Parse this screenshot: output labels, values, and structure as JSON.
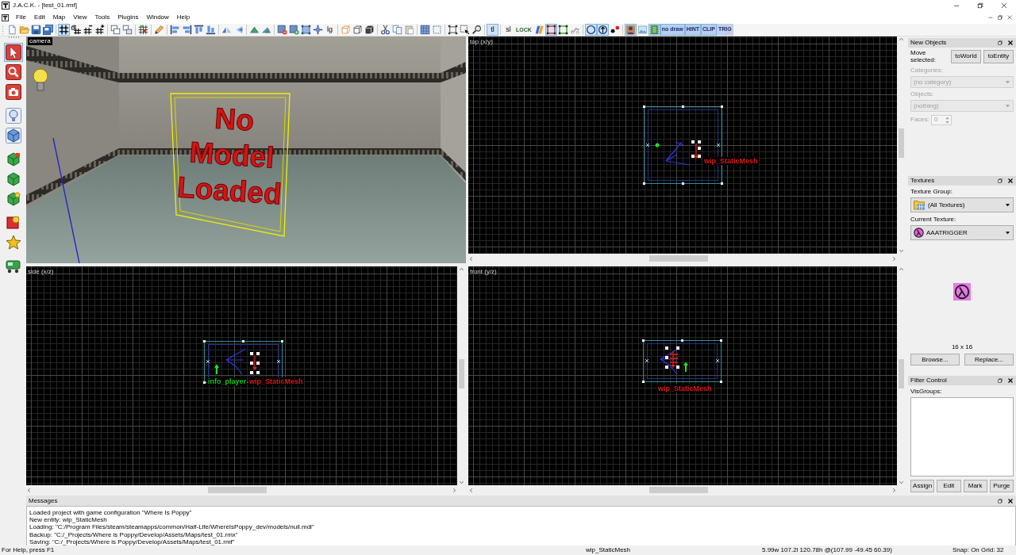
{
  "window": {
    "title": "J.A.C.K. - [test_01.rmf]"
  },
  "menu": [
    "File",
    "Edit",
    "Map",
    "View",
    "Tools",
    "Plugins",
    "Window",
    "Help"
  ],
  "toolbar": [
    {
      "buttons": [
        {
          "kind": "icon",
          "on": false
        },
        {
          "kind": "icon",
          "on": false
        },
        {
          "kind": "icon",
          "on": false
        },
        {
          "kind": "icon",
          "on": false
        }
      ]
    },
    {
      "buttons": [
        {
          "kind": "icon",
          "on": true
        },
        {
          "kind": "icon",
          "on": false
        },
        {
          "kind": "icon",
          "on": false
        },
        {
          "kind": "icon",
          "on": false
        }
      ]
    },
    {
      "buttons": [
        {
          "kind": "icon",
          "on": false
        },
        {
          "kind": "icon",
          "on": false
        }
      ]
    },
    {
      "buttons": [
        {
          "kind": "icon",
          "on": false
        }
      ]
    },
    {
      "buttons": [
        {
          "kind": "icon",
          "on": false
        }
      ]
    },
    {
      "buttons": [
        {
          "kind": "icon",
          "on": false
        },
        {
          "kind": "icon",
          "on": false
        },
        {
          "kind": "icon",
          "on": false
        },
        {
          "kind": "icon",
          "on": false
        }
      ]
    },
    {
      "buttons": [
        {
          "kind": "icon",
          "on": false
        },
        {
          "kind": "icon",
          "on": false
        }
      ]
    },
    {
      "buttons": [
        {
          "kind": "icon",
          "on": false
        },
        {
          "kind": "icon",
          "on": false
        }
      ]
    },
    {
      "buttons": [
        {
          "kind": "icon",
          "on": false
        },
        {
          "kind": "icon",
          "on": false
        },
        {
          "kind": "icon",
          "on": false
        },
        {
          "kind": "icon",
          "on": false
        },
        {
          "kind": "text",
          "label": "lg",
          "on": false
        }
      ]
    },
    {
      "buttons": [
        {
          "kind": "icon",
          "on": false
        },
        {
          "kind": "icon",
          "on": false
        },
        {
          "kind": "icon",
          "on": false
        }
      ]
    },
    {
      "buttons": [
        {
          "kind": "icon",
          "on": false
        },
        {
          "kind": "icon",
          "on": false
        },
        {
          "kind": "icon",
          "on": false
        }
      ]
    },
    {
      "buttons": [
        {
          "kind": "icon",
          "on": false
        },
        {
          "kind": "icon",
          "on": false
        }
      ]
    },
    {
      "buttons": [
        {
          "kind": "icon",
          "on": false
        },
        {
          "kind": "icon",
          "on": false
        },
        {
          "kind": "icon",
          "on": false
        }
      ]
    },
    {
      "buttons": [
        {
          "kind": "text",
          "label": "tl",
          "on": true
        }
      ]
    },
    {
      "buttons": [
        {
          "kind": "text",
          "label": "sl",
          "on": false
        },
        {
          "kind": "tiny",
          "label": "LOCK",
          "on": false
        },
        {
          "kind": "icon",
          "on": false
        },
        {
          "kind": "icon",
          "on": true
        },
        {
          "kind": "icon",
          "on": false
        },
        {
          "kind": "icon",
          "on": false
        }
      ]
    },
    {
      "buttons": [
        {
          "kind": "icon",
          "on": true
        },
        {
          "kind": "icon",
          "on": true
        },
        {
          "kind": "icon",
          "on": false
        }
      ]
    },
    {
      "buttons": [
        {
          "kind": "icon",
          "on": true
        },
        {
          "kind": "icon",
          "on": false
        },
        {
          "kind": "icon",
          "on": true
        },
        {
          "kind": "tile",
          "label": "no draw",
          "on": true
        },
        {
          "kind": "tile",
          "label": "HINT",
          "on": true
        },
        {
          "kind": "tile",
          "label": "CLIP",
          "on": true
        },
        {
          "kind": "tile",
          "label": "TRIG",
          "on": false
        }
      ]
    }
  ],
  "tool_palette": [
    {
      "buttons": [
        {
          "selected": true
        },
        {
          "selected": false
        },
        {
          "selected": false
        }
      ]
    },
    {
      "buttons": [
        {
          "selected": false
        },
        {
          "selected": false
        }
      ]
    },
    {
      "buttons": [
        {
          "selected": false
        },
        {
          "selected": false
        },
        {
          "selected": false
        }
      ]
    },
    {
      "buttons": [
        {
          "selected": false
        },
        {
          "selected": false
        }
      ]
    },
    {
      "buttons": [
        {
          "selected": false
        }
      ]
    }
  ],
  "viewports": [
    {
      "kind": "camera",
      "label": "camera",
      "model_text": "No Model Loaded"
    },
    {
      "kind": "top",
      "label": "top (x/y)",
      "entity_labels": [
        {
          "text": "wip_StaticMesh",
          "color": "#e01818"
        }
      ]
    },
    {
      "kind": "side",
      "label": "side (x/z)",
      "entity_labels": [
        {
          "text": "info_player",
          "color": "#18c818"
        },
        {
          "text": "wip_StaticMesh",
          "color": "#e01818"
        }
      ]
    },
    {
      "kind": "front",
      "label": "front (y/z)",
      "entity_labels": [
        {
          "text": "wip_StaticMesh",
          "color": "#e01818"
        }
      ]
    }
  ],
  "new_objects": {
    "title": "New Objects",
    "move_label": "Move selected:",
    "buttons": [
      "toWorld",
      "toEntity"
    ],
    "categories": {
      "label": "Categories:",
      "value": "(no category)",
      "disabled": true
    },
    "objects": {
      "label": "Objects:",
      "value": "(nothing)",
      "disabled": true
    },
    "faces": {
      "label": "Faces:",
      "value": "0",
      "disabled": true
    }
  },
  "textures": {
    "title": "Textures",
    "group": {
      "label": "Texture Group:",
      "value": "(All Textures)"
    },
    "current": {
      "label": "Current Texture:",
      "value": "AAATRIGGER"
    },
    "size": "16 x 16",
    "buttons": [
      "Browse...",
      "Replace..."
    ]
  },
  "filter_control": {
    "title": "Filter Control",
    "visgroups_label": "VisGroups:",
    "buttons": [
      "Assign",
      "Edit",
      "Mark",
      "Purge"
    ]
  },
  "messages": {
    "title": "Messages",
    "lines": [
      "Loaded project with game configuration \"Where Is Poppy\"",
      "New entity: wip_StaticMesh",
      "Loading: \"C:/Program Files/steam/steamapps/common/Half-Life/WhereIsPoppy_dev/models/null.mdl\"",
      "Backup: \"C:/_Projects/Where is Poppy/Develop/Assets/Maps/test_01.rmx\"",
      "Saving: \"C:/_Projects/Where is Poppy/Develop/Assets/Maps/test_01.rmf\""
    ]
  },
  "status_bar": [
    "For Help, press F1",
    "wip_StaticMesh",
    "5.99w 107.2l 120.78h @(107.99 -49.45 60.39)",
    "Snap: On Grid: 32"
  ]
}
